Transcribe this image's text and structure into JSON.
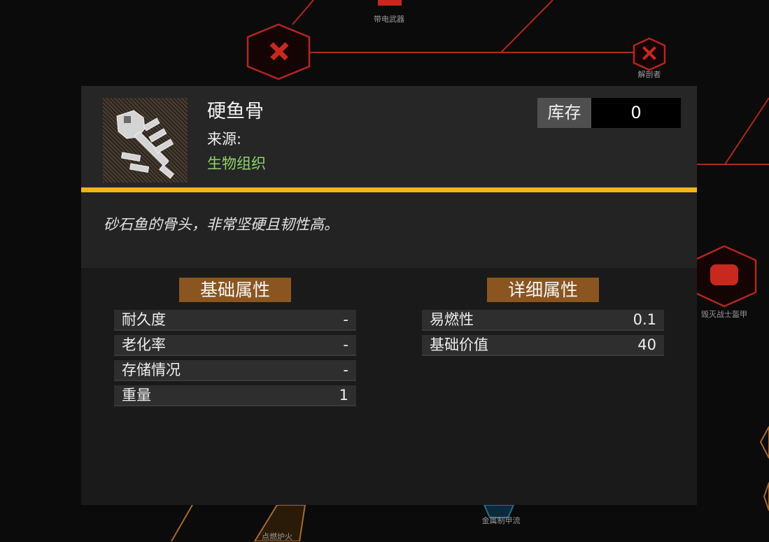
{
  "background": {
    "nodes": [
      {
        "label": "带电武器",
        "icon": "electric-weapon-icon"
      },
      {
        "label": "",
        "icon": "crossed-swords-icon"
      },
      {
        "label": "解剖者",
        "icon": "crossed-tools-icon"
      },
      {
        "label": "毁灭战士盔甲",
        "icon": "armor-helmet-icon"
      },
      {
        "label": "点燃炉火",
        "icon": "fire-icon"
      },
      {
        "label": "金属制甲流",
        "icon": "metal-icon"
      }
    ],
    "line_color": "#b3261e"
  },
  "item": {
    "name": "硬鱼骨",
    "source_label": "来源:",
    "source_value": "生物组织",
    "icon": "fish-bone-icon",
    "stock_label": "库存",
    "stock_value": "0",
    "description": "砂石鱼的骨头，非常坚硬且韧性高。"
  },
  "basic_attributes": {
    "title": "基础属性",
    "rows": [
      {
        "label": "耐久度",
        "value": "-"
      },
      {
        "label": "老化率",
        "value": "-"
      },
      {
        "label": "存储情况",
        "value": "-"
      },
      {
        "label": "重量",
        "value": "1"
      }
    ]
  },
  "detail_attributes": {
    "title": "详细属性",
    "rows": [
      {
        "label": "易燃性",
        "value": "0.1"
      },
      {
        "label": "基础价值",
        "value": "40"
      }
    ]
  },
  "colors": {
    "accent": "#f2b31c",
    "source_green": "#8fd36a",
    "section_brown": "#8a5520"
  }
}
